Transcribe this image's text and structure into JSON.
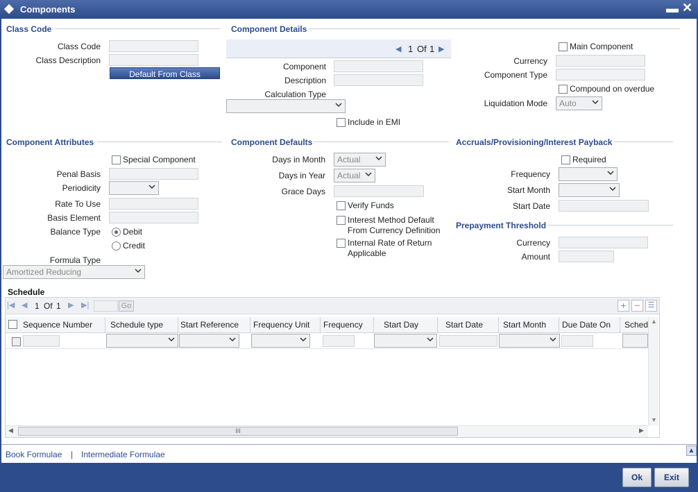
{
  "window": {
    "title": "Components",
    "minimize": "▬",
    "close": "✕"
  },
  "sections": {
    "class_code": "Class Code",
    "component_details": "Component Details",
    "component_attributes": "Component Attributes",
    "component_defaults": "Component Defaults",
    "accruals": "Accruals/Provisioning/Interest Payback",
    "prepayment": "Prepayment Threshold"
  },
  "class_code": {
    "class_code_label": "Class Code",
    "class_description_label": "Class Description",
    "default_button": "Default From Class"
  },
  "details": {
    "pager": {
      "current": "1",
      "of": "Of",
      "total": "1"
    },
    "component_label": "Component",
    "description_label": "Description",
    "calculation_type_label": "Calculation Type",
    "include_emi": "Include in EMI",
    "main_component": "Main Component",
    "currency_label": "Currency",
    "component_type_label": "Component Type",
    "compound_overdue": "Compound on overdue",
    "liquidation_mode_label": "Liquidation Mode",
    "liquidation_mode_value": "Auto"
  },
  "attributes": {
    "special_component": "Special Component",
    "penal_basis_label": "Penal Basis",
    "periodicity_label": "Periodicity",
    "rate_to_use_label": "Rate To Use",
    "basis_element_label": "Basis Element",
    "balance_type_label": "Balance Type",
    "debit": "Debit",
    "credit": "Credit",
    "formula_type_label": "Formula Type",
    "formula_type_value": "Amortized Reducing"
  },
  "defaults": {
    "days_in_month_label": "Days in Month",
    "days_in_month_value": "Actual",
    "days_in_year_label": "Days in Year",
    "days_in_year_value": "Actual",
    "grace_days_label": "Grace Days",
    "verify_funds": "Verify Funds",
    "interest_method_line1": "Interest Method Default",
    "interest_method_line2": "From Currency Definition",
    "irr_line1": "Internal Rate of Return",
    "irr_line2": "Applicable"
  },
  "accruals": {
    "required": "Required",
    "frequency_label": "Frequency",
    "start_month_label": "Start Month",
    "start_date_label": "Start Date"
  },
  "prepayment": {
    "currency_label": "Currency",
    "amount_label": "Amount"
  },
  "schedule": {
    "title": "Schedule",
    "pager": {
      "current": "1",
      "of": "Of",
      "total": "1",
      "go": "Go"
    },
    "columns": [
      "Sequence Number",
      "Schedule type",
      "Start Reference",
      "Frequency Unit",
      "Frequency",
      "Start Day",
      "Start Date",
      "Start Month",
      "Due Date On",
      "Schedule"
    ],
    "scroll_grip": "III"
  },
  "links": {
    "book_formulae": "Book Formulae",
    "separator": "|",
    "intermediate_formulae": "Intermediate Formulae"
  },
  "footer": {
    "ok": "Ok",
    "exit": "Exit"
  }
}
